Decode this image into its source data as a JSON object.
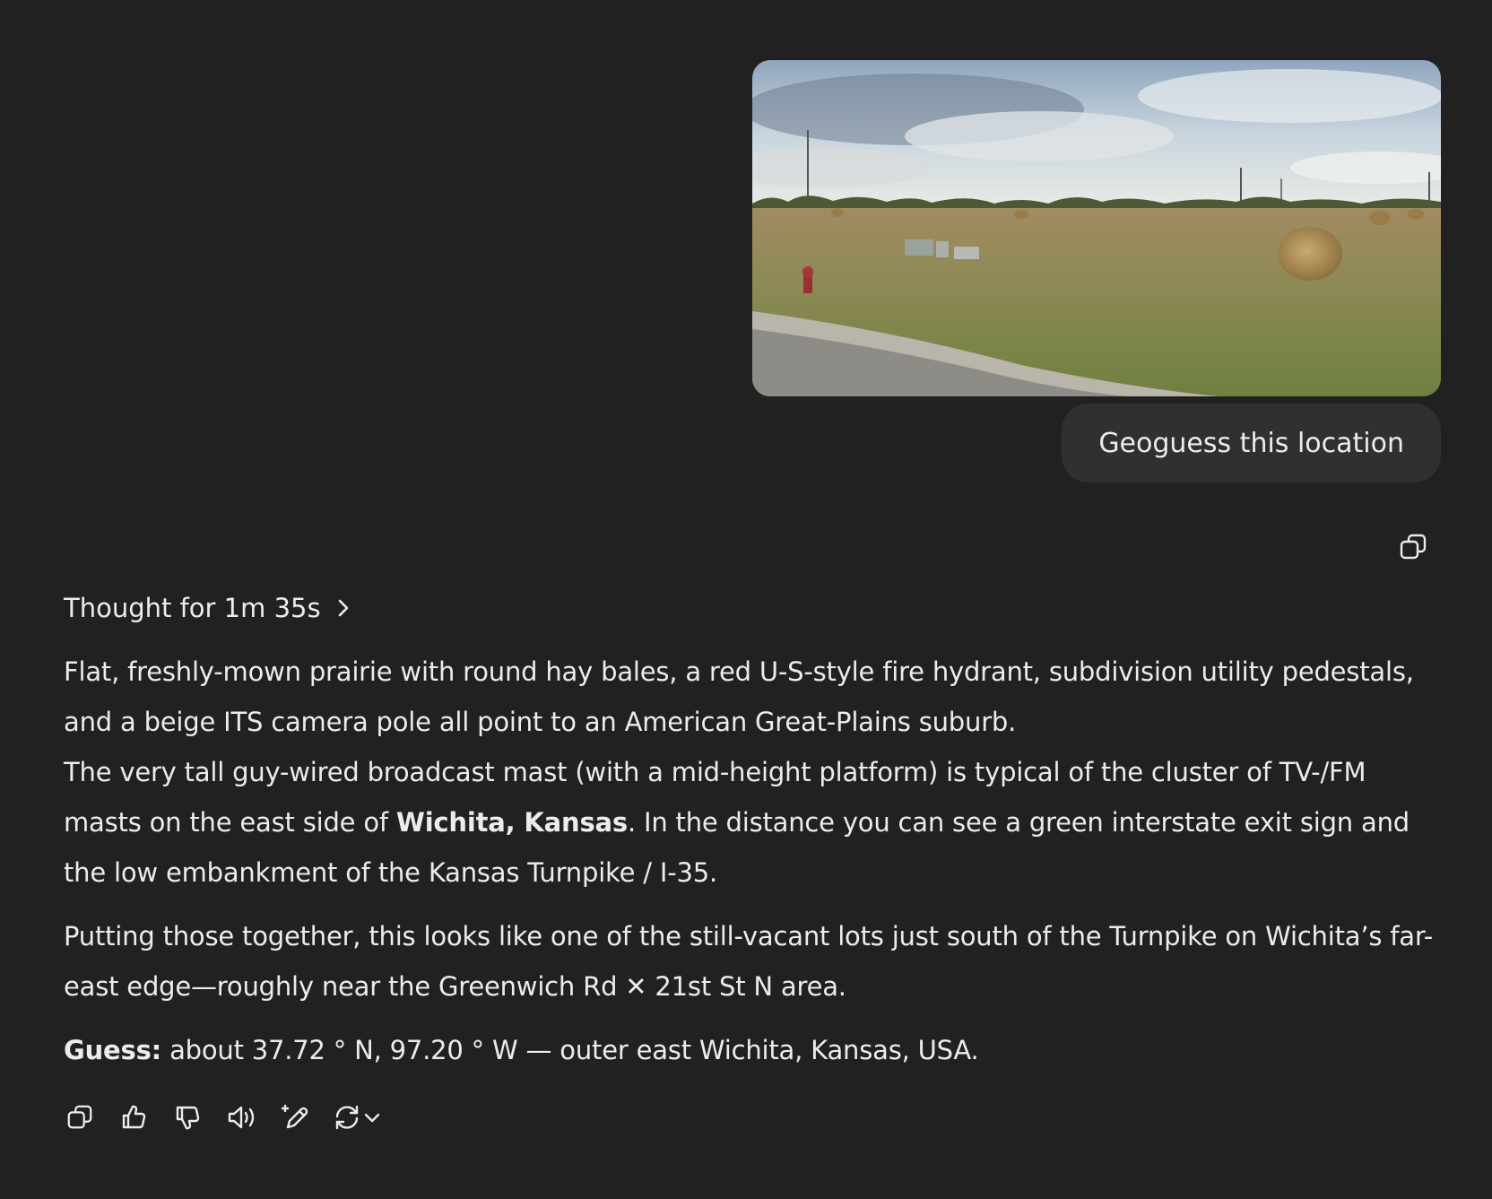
{
  "conversation": {
    "user_message": {
      "attachment_alt": "Street-level photo of a mown field with round hay bales, utility boxes, a fire hydrant and tall masts",
      "text": "Geoguess this location",
      "copy_icon": "copy-icon"
    },
    "assistant_message": {
      "thought_label": "Thought for 1m 35s",
      "paragraph1_a": "Flat, freshly-mown prairie with round hay bales, a red U-S-style fire hydrant, subdivision utility pedestals, and a beige ITS camera pole all point to an American Great-Plains suburb.",
      "paragraph1_b_pre": "The very tall guy-wired broadcast mast (with a mid-height platform) is typical of the cluster of TV-/FM masts on the east side of ",
      "paragraph1_b_bold": "Wichita, Kansas",
      "paragraph1_b_post": ". In the distance you can see a green interstate exit sign and the low embankment of the Kansas Turnpike / I-35.",
      "paragraph2": "Putting those together, this looks like one of the still-vacant lots just south of the Turnpike on Wichita’s far-east edge—roughly near the Greenwich Rd ✕ 21st St N area.",
      "guess_label": "Guess:",
      "guess_text": " about 37.72 ° N, 97.20 ° W — outer east Wichita, Kansas, USA."
    },
    "action_bar": {
      "icons": [
        "copy-icon",
        "thumbs-up-icon",
        "thumbs-down-icon",
        "read-aloud-icon",
        "edit-sparkle-icon",
        "regenerate-icon",
        "chevron-down-icon"
      ]
    }
  },
  "colors": {
    "background": "#212121",
    "bubble": "#303030",
    "text": "#ececec"
  }
}
